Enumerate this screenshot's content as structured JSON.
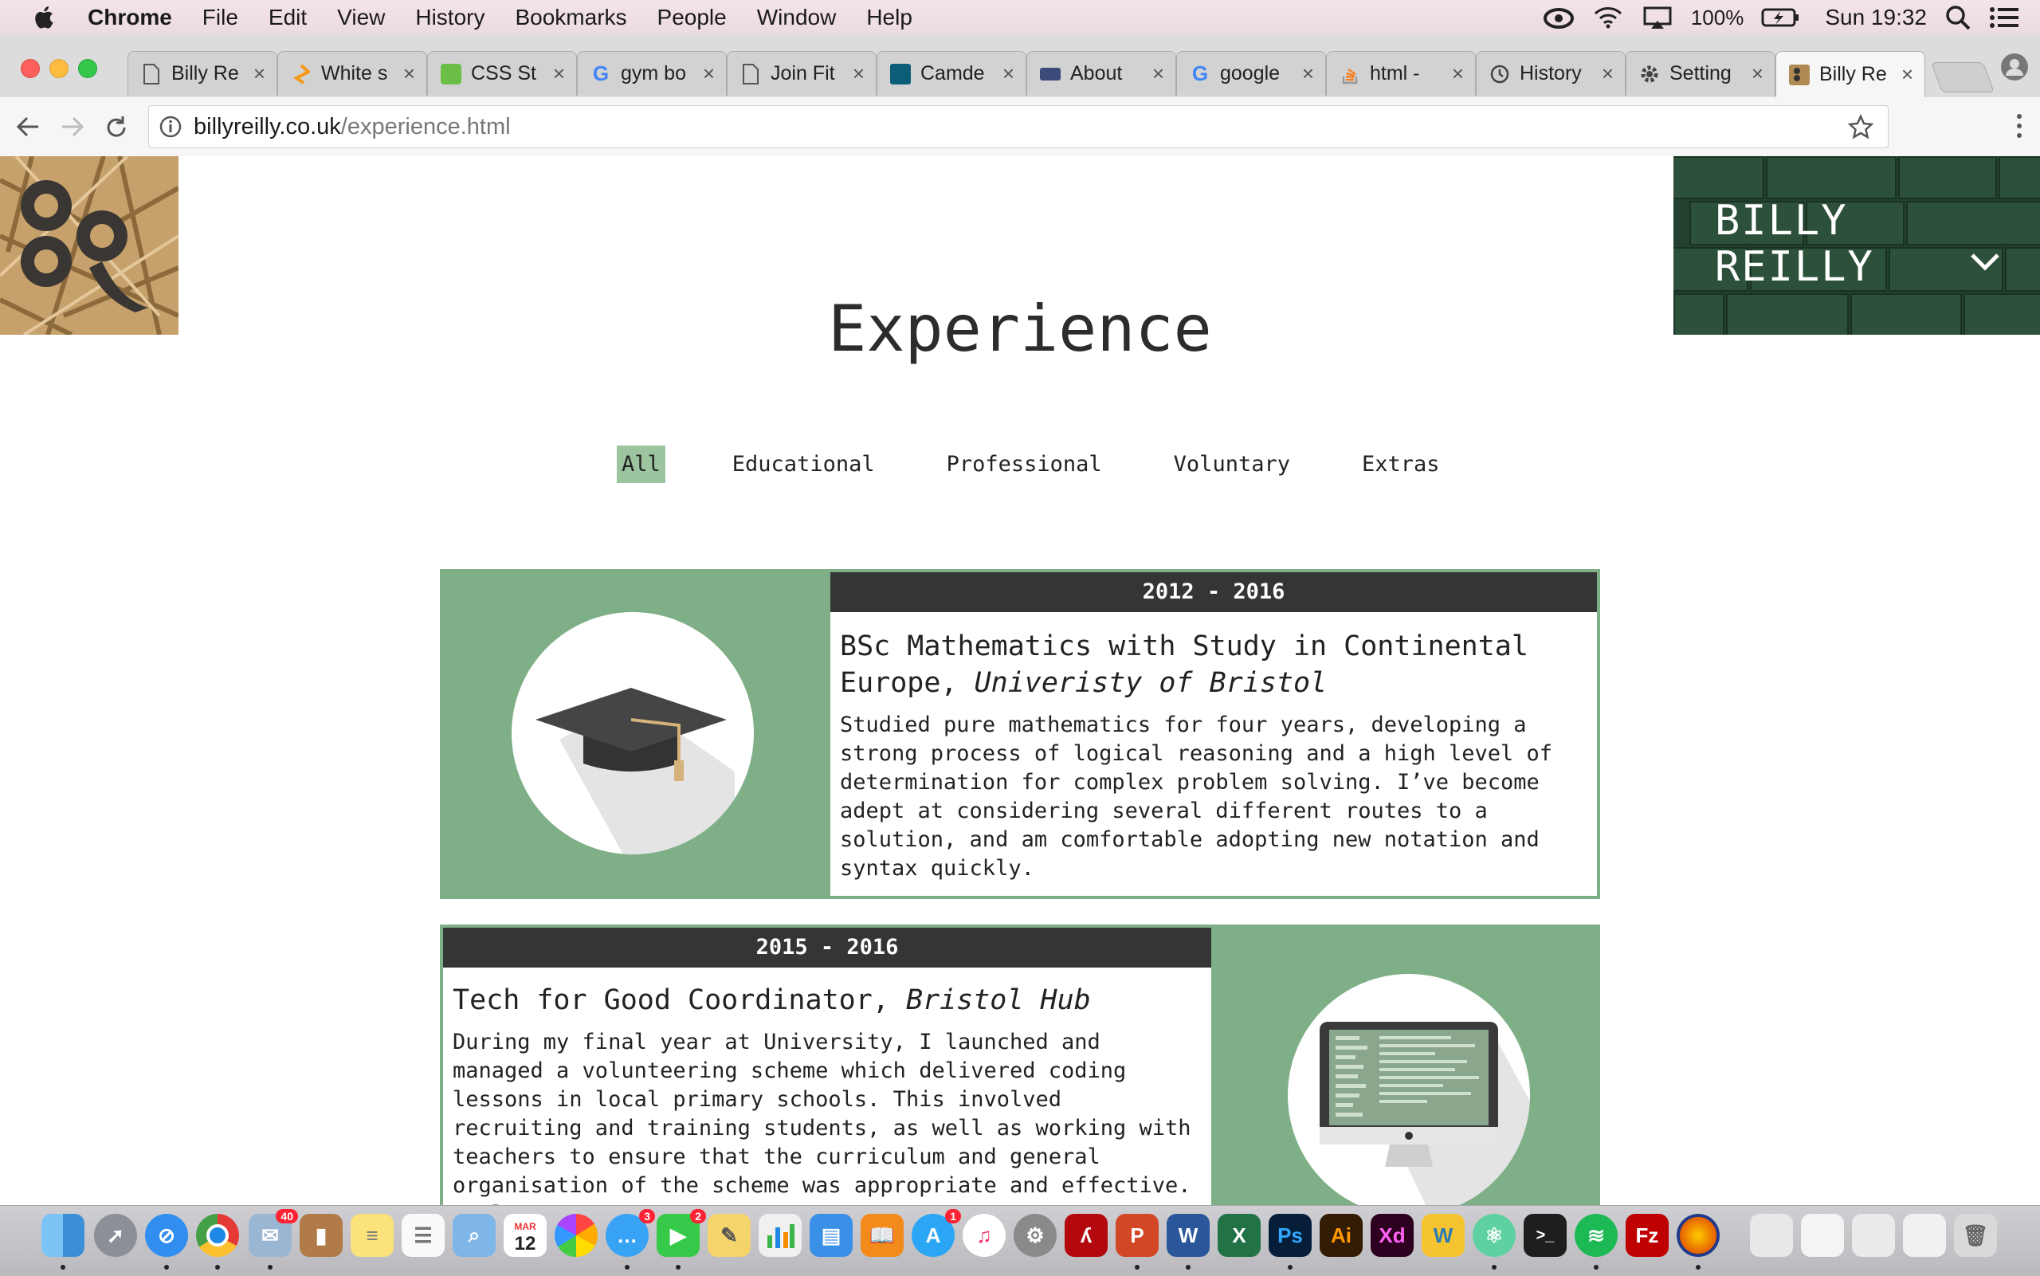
{
  "menubar": {
    "app": "Chrome",
    "items": [
      "File",
      "Edit",
      "View",
      "History",
      "Bookmarks",
      "People",
      "Window",
      "Help"
    ],
    "battery": "100%",
    "clock": "Sun 19:32"
  },
  "tabs": [
    {
      "title": "Billy Re",
      "icon": "page-icon"
    },
    {
      "title": "White s",
      "icon": "sublime-icon"
    },
    {
      "title": "CSS St",
      "icon": "w3c-icon"
    },
    {
      "title": "gym bo",
      "icon": "google-icon"
    },
    {
      "title": "Join Fit",
      "icon": "page-icon"
    },
    {
      "title": "Camde",
      "icon": "camden-icon"
    },
    {
      "title": "About",
      "icon": "fbs-icon"
    },
    {
      "title": "google",
      "icon": "google-icon"
    },
    {
      "title": "html -",
      "icon": "stackoverflow-icon"
    },
    {
      "title": "History",
      "icon": "history-icon"
    },
    {
      "title": "Setting",
      "icon": "gear-icon"
    },
    {
      "title": "Billy Re",
      "icon": "site-logo-icon",
      "active": true
    }
  ],
  "address": {
    "host": "billyreilly.co.uk",
    "path": "/experience.html"
  },
  "page": {
    "brand_line1": "BILLY",
    "brand_line2": "REILLY",
    "title": "Experience",
    "filters": [
      "All",
      "Educational",
      "Professional",
      "Voluntary",
      "Extras"
    ],
    "active_filter": "All",
    "cards": [
      {
        "dates": "2012 - 2016",
        "title": "BSc Mathematics with Study in Continental Europe,",
        "org": "Univeristy of Bristol",
        "body": "Studied pure mathematics for four years, developing a strong process of logical reasoning and a high level of determination for complex problem solving. I’ve become adept at considering several different routes to a solution, and am comfortable adopting new notation and syntax quickly.",
        "icon": "graduation-cap-icon"
      },
      {
        "dates": "2015 - 2016",
        "title": "Tech for Good Coordinator,",
        "org": "Bristol Hub",
        "body": "During my final year at University, I launched and managed a volunteering scheme which delivered coding lessons in local primary schools. This involved recruiting and training students, as well as working with teachers to ensure that the curriculum and general organisation of the scheme was appropriate and effective. I also oversaw a",
        "icon": "desktop-computer-icon"
      }
    ]
  },
  "dock": {
    "calendar_month": "MAR",
    "calendar_day": "12",
    "badges": {
      "mail": "40",
      "messages": "3",
      "facetime": "2",
      "appstore": "1"
    }
  },
  "colors": {
    "accent_green": "#7eaf86",
    "filter_active": "#9cc59f",
    "brand_dark_green": "#24412f",
    "date_bar": "#353535"
  }
}
